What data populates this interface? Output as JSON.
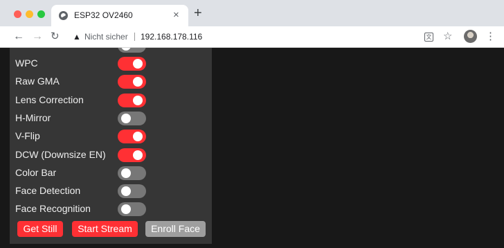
{
  "browser": {
    "tab_title": "ESP32 OV2460",
    "tab_close": "×",
    "new_tab": "+",
    "security_label": "Nicht sicher",
    "url": "192.168.178.116"
  },
  "toggles": [
    {
      "label": "WPC",
      "on": true
    },
    {
      "label": "Raw GMA",
      "on": true
    },
    {
      "label": "Lens Correction",
      "on": true
    },
    {
      "label": "H-Mirror",
      "on": false
    },
    {
      "label": "V-Flip",
      "on": true
    },
    {
      "label": "DCW (Downsize EN)",
      "on": true
    },
    {
      "label": "Color Bar",
      "on": false
    },
    {
      "label": "Face Detection",
      "on": false
    },
    {
      "label": "Face Recognition",
      "on": false
    }
  ],
  "buttons": {
    "get_still": "Get Still",
    "start_stream": "Start Stream",
    "enroll_face": "Enroll Face"
  },
  "colors": {
    "accent": "#ff3034",
    "panel": "#363636",
    "background": "#181818",
    "toggle_off": "#777777",
    "button_disabled": "#9e9e9e"
  }
}
